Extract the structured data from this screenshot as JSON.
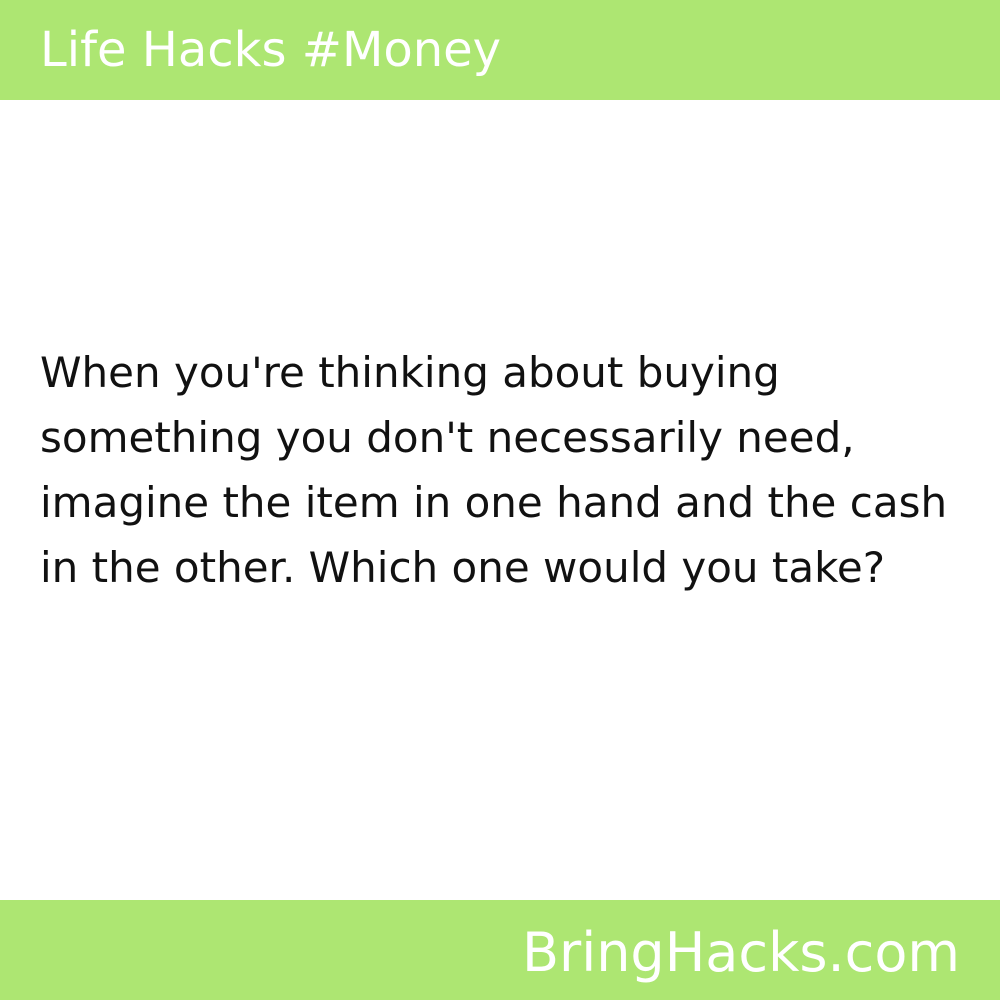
{
  "header": {
    "title": "Life Hacks #Money"
  },
  "content": {
    "tip": "When you're thinking about buying something you don't necessarily need, imagine the item in one hand and the cash in the other. Which one would you take?"
  },
  "footer": {
    "site": "BringHacks.com"
  },
  "colors": {
    "bar": "#ade672",
    "bar_text": "#ffffff",
    "body_text": "#111111",
    "background": "#ffffff"
  }
}
